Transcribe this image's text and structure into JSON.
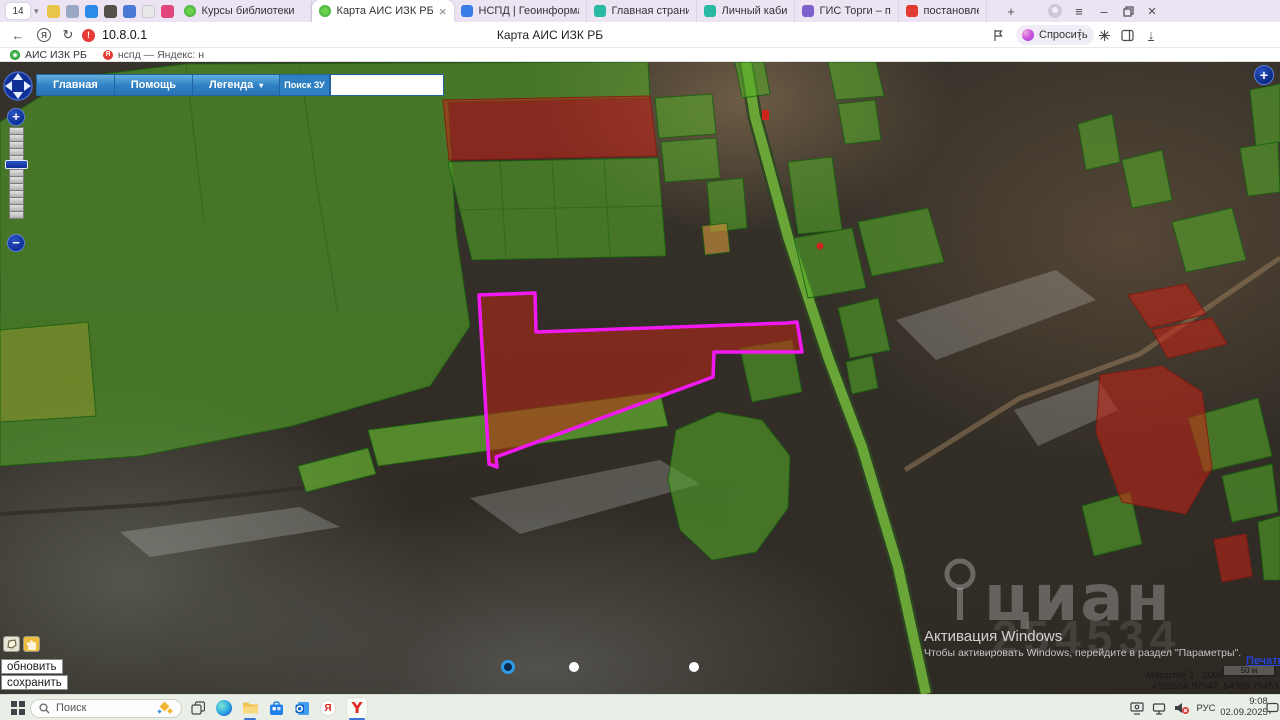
{
  "browser": {
    "tab_count": "14",
    "pinned_favicons": [
      {
        "name": "mail-pinned-favicon",
        "color": "#e8c44a"
      },
      {
        "name": "shield-pinned-favicon",
        "color": "#9aa7c4"
      },
      {
        "name": "messenger-pinned-favicon",
        "color": "#2b8ce8"
      },
      {
        "name": "scan-pinned-favicon",
        "color": "#55514b"
      },
      {
        "name": "globe-pinned-favicon",
        "color": "#4a7bd4"
      },
      {
        "name": "document-pinned-favicon",
        "color": "#e9e9ec"
      },
      {
        "name": "w-pinned-favicon",
        "color": "#e0457b"
      }
    ],
    "tabs": [
      {
        "label": "Курсы библиотеки",
        "active": false
      },
      {
        "label": "Карта АИС ИЗК РБ",
        "active": true
      },
      {
        "label": "НСПД | Геоинформаци",
        "active": false
      },
      {
        "label": "Главная страница",
        "active": false
      },
      {
        "label": "Личный кабинет",
        "active": false
      },
      {
        "label": "ГИС Торги – продажи п",
        "active": false
      },
      {
        "label": "постановление.pdf",
        "active": false
      }
    ],
    "address": {
      "url": "10.8.0.1",
      "page_title": "Карта АИС ИЗК РБ",
      "ask_button": "Спросить"
    },
    "bookmarks": [
      {
        "label": "АИС ИЗК РБ"
      },
      {
        "label": "нспд — Яндекс: н"
      }
    ]
  },
  "map": {
    "toolbar": {
      "home": "Главная",
      "help": "Помощь",
      "legend": "Легенда",
      "search_label": "Поиск ЗУ",
      "search_value": ""
    },
    "actions": {
      "refresh": "обновить",
      "save": "сохранить"
    },
    "footer": {
      "print_link": "Печать",
      "scale_text": "Масштаб 1 : 2000",
      "scale_bar_label": "50 м",
      "coordinates": "4163556.97547, 54308.79453"
    },
    "watermark": {
      "brand": "циан",
      "digits": "254534"
    },
    "win_activation": {
      "line1": "Активация Windows",
      "line2": "Чтобы активировать Windows, перейдите в раздел \"Параметры\"."
    }
  },
  "taskbar": {
    "search_label": "Поиск",
    "language": "РУС",
    "time": "9:08",
    "date": "02.09.2025"
  },
  "icons": {
    "back": "←",
    "refresh": "↻",
    "more_vertical": "⋮",
    "menu": "≡",
    "minimize": "–",
    "close": "×",
    "new_tab": "+",
    "chevron_down": "▾",
    "download": "↓",
    "plus": "+",
    "minus": "−",
    "warning": "!"
  },
  "colors": {
    "accent_blue": "#2f80c3",
    "parcel_green": "#4caf23",
    "parcel_red": "#c62314",
    "selection_outline": "#ff1aff",
    "active_underline": "#3c77d8",
    "warning_red": "#e53935"
  }
}
